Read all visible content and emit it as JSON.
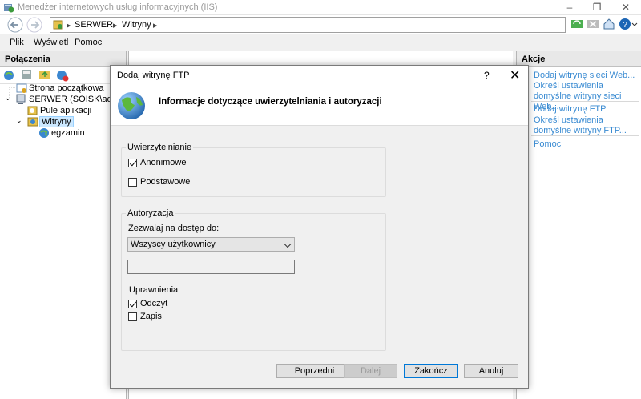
{
  "window": {
    "title": "Menedżer internetowych usług informacyjnych (IIS)",
    "minimize": "–",
    "maximize": "❐",
    "close": "✕"
  },
  "address": {
    "separator": "▸",
    "crumbs": [
      "SERWER",
      "Witryny"
    ]
  },
  "menu": {
    "items": [
      "Plik",
      "Wyświetl",
      "Pomoc"
    ]
  },
  "connections": {
    "header": "Połączenia",
    "tree": [
      "Strona początkowa",
      "SERWER (SOISK\\administ",
      "Pule aplikacji",
      "Witryny",
      "egzamin"
    ]
  },
  "actions": {
    "header": "Akcje",
    "links": [
      "Dodaj witrynę sieci Web...",
      "Określ ustawienia domyślne witryny sieci Web...",
      "Dodaj witrynę FTP",
      "Określ ustawienia domyślne witryny FTP...",
      "Pomoc"
    ]
  },
  "dialog": {
    "title": "Dodaj witrynę FTP",
    "help": "?",
    "close": "✕",
    "header": "Informacje dotyczące uwierzytelniania i autoryzacji",
    "auth": {
      "label": "Uwierzytelnianie",
      "anonymous": "Anonimowe",
      "anonymous_checked": true,
      "basic": "Podstawowe",
      "basic_checked": false
    },
    "authorization": {
      "label": "Autoryzacja",
      "allow_label": "Zezwalaj na dostęp do:",
      "allow_value": "Wszyscy użytkownicy",
      "textbox_value": "",
      "permissions_label": "Uprawnienia",
      "read": "Odczyt",
      "read_checked": true,
      "write": "Zapis",
      "write_checked": false
    },
    "buttons": {
      "previous": "Poprzedni",
      "next": "Dalej",
      "finish": "Zakończ",
      "cancel": "Anuluj"
    }
  },
  "colors": {
    "link": "#3a8bd2",
    "selection": "#cce8ff",
    "accent": "#0078d7"
  }
}
